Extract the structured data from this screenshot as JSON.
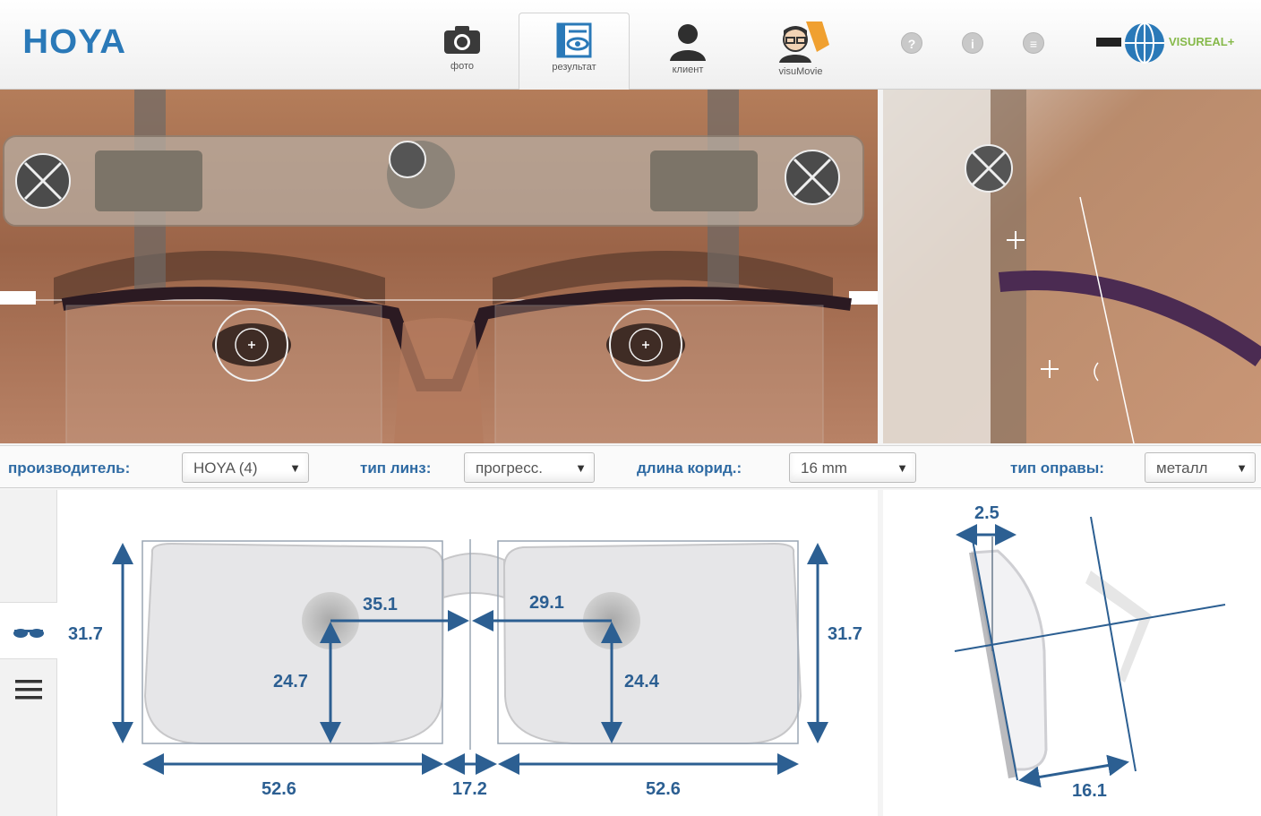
{
  "header": {
    "logo": "HOYA",
    "tabs": [
      {
        "label": "фото",
        "icon": "camera-icon"
      },
      {
        "label": "результат",
        "icon": "result-icon"
      },
      {
        "label": "клиент",
        "icon": "client-icon"
      },
      {
        "label": "visuMovie",
        "icon": "visumovie-icon"
      }
    ],
    "active_tab": "результат",
    "help_icons": [
      "question-icon",
      "info-icon",
      "settings-icon"
    ],
    "product_logo": "VISUREAL+"
  },
  "controls": {
    "manufacturer_label": "производитель:",
    "manufacturer_value": "HOYA (4)",
    "lens_type_label": "тип линз:",
    "lens_type_value": "прогресс.",
    "corridor_label": "длина корид.:",
    "corridor_value": "16 mm",
    "frame_type_label": "тип оправы:",
    "frame_type_value": "металл"
  },
  "measurements": {
    "left_height": "31.7",
    "right_height": "31.7",
    "left_pd": "35.1",
    "right_pd": "29.1",
    "left_fitting_height": "24.7",
    "right_fitting_height": "24.4",
    "left_lens_width": "52.6",
    "bridge": "17.2",
    "right_lens_width": "52.6"
  },
  "side_measurements": {
    "tilt": "2.5",
    "vertex": "16.1"
  },
  "colors": {
    "accent": "#2a79b8",
    "dimension": "#2c5f92",
    "label": "#2e6aa3"
  }
}
